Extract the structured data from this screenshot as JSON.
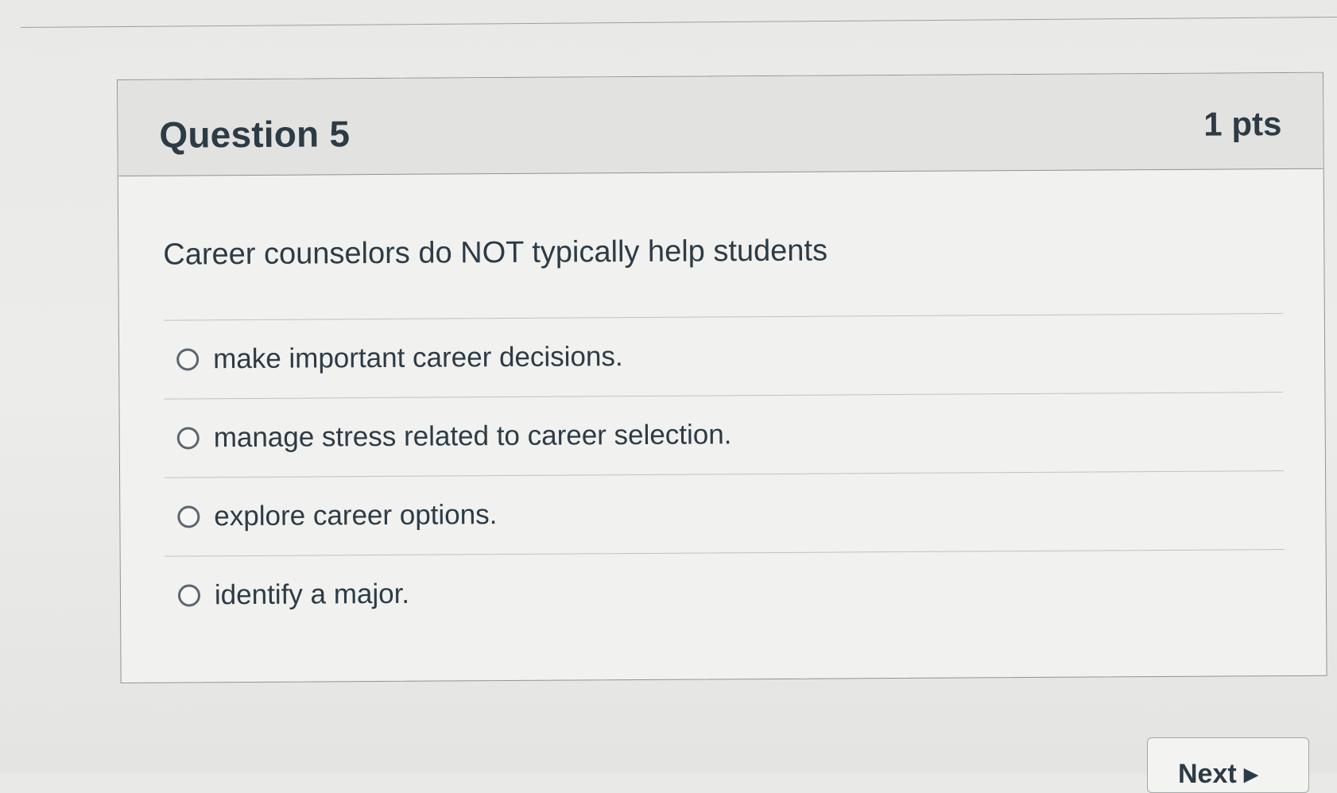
{
  "question": {
    "title": "Question 5",
    "points": "1 pts",
    "prompt": "Career counselors do NOT typically help students",
    "answers": [
      {
        "label": "make important career decisions.",
        "selected": false
      },
      {
        "label": "manage stress related to career selection.",
        "selected": false
      },
      {
        "label": "explore career options.",
        "selected": false
      },
      {
        "label": "identify a major.",
        "selected": false
      }
    ]
  },
  "navigation": {
    "next_label": "Next ▸"
  }
}
